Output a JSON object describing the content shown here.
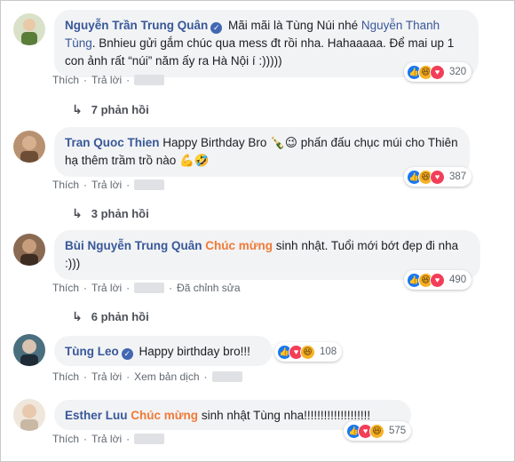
{
  "colors": {
    "name": "#385898",
    "highlight": "#f07a36",
    "bubble": "#f2f3f5",
    "link": "#606770"
  },
  "actions": {
    "like": "Thích",
    "reply": "Trả lời",
    "sep": "·",
    "edited": "Đã chỉnh sửa",
    "translate": "Xem bản dịch"
  },
  "comments": [
    {
      "name": "Nguyễn Trần Trung Quân",
      "verified": true,
      "text_a": "Mãi mãi là Tùng Núi nhé ",
      "mention": "Nguyễn Thanh Tùng",
      "text_b": ". Bnhieu gửi gắm chúc qua mess đt rồi nha. Hahaaaaa. Để mai up 1 con ảnh rất “núi” năm ấy ra Hà Nội í :)))))",
      "reaction_icons": [
        "like-icon",
        "haha-icon",
        "love-icon"
      ],
      "reaction_count": "320",
      "replies": "7 phản hồi"
    },
    {
      "name": "Tran Quoc Thien",
      "text_a": "Happy Birthday Bro 🍾😉 phấn đấu chục múi cho Thiên hạ thêm trầm trồ nào 💪🤣",
      "reaction_icons": [
        "like-icon",
        "haha-icon",
        "love-icon"
      ],
      "reaction_count": "387",
      "replies": "3 phản hồi"
    },
    {
      "name": "Bùi Nguyễn Trung Quân",
      "highlight": "Chúc mừng",
      "text_a": " sinh nhật. Tuổi mới bớt đẹp đi nha :)))",
      "reaction_icons": [
        "like-icon",
        "haha-icon",
        "love-icon"
      ],
      "reaction_count": "490",
      "replies": "6 phản hồi"
    },
    {
      "name": "Tùng Leo",
      "verified": true,
      "text_a": "Happy birthday bro!!!",
      "reaction_icons": [
        "like-icon",
        "love-icon",
        "haha-icon"
      ],
      "reaction_count": "108"
    },
    {
      "name": "Esther Luu",
      "highlight": "Chúc mừng",
      "text_a": " sinh nhật Tùng nha!!!!!!!!!!!!!!!!!!!!",
      "reaction_icons": [
        "like-icon",
        "love-icon",
        "haha-icon"
      ],
      "reaction_count": "575"
    }
  ]
}
